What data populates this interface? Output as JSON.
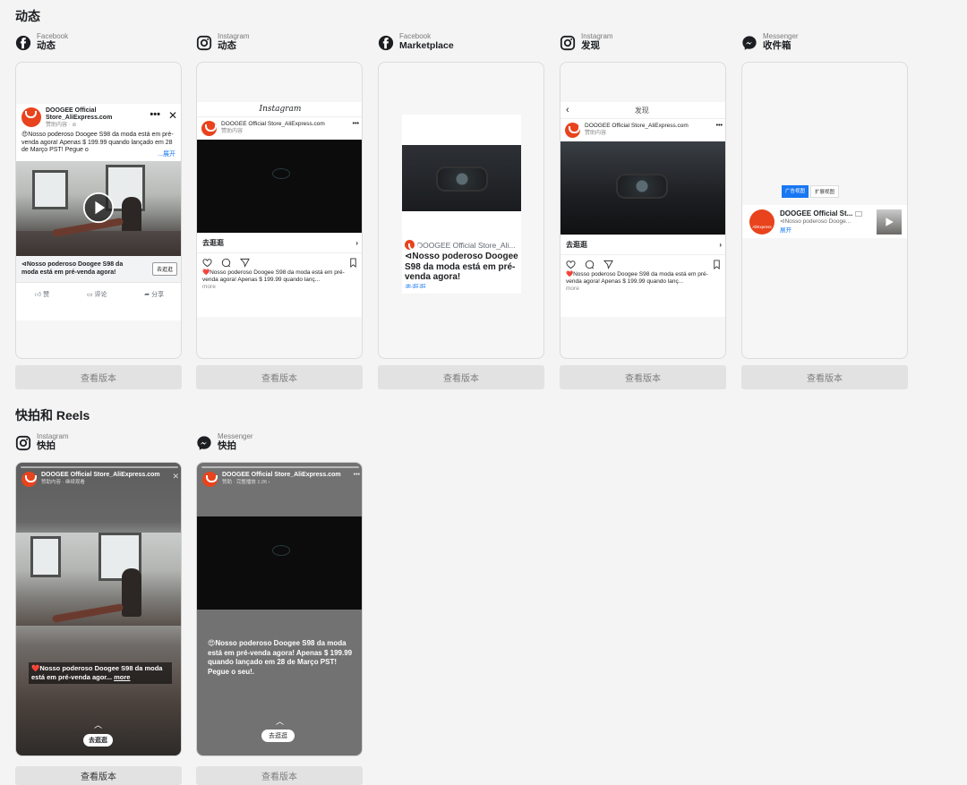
{
  "sections": {
    "feeds_title": "动态",
    "stories_title": "快拍和 Reels"
  },
  "view_label": "查看版本",
  "feeds": [
    {
      "platform": "Facebook",
      "name": "动态",
      "icon": "facebook-icon"
    },
    {
      "platform": "Instagram",
      "name": "动态",
      "icon": "instagram-icon"
    },
    {
      "platform": "Facebook",
      "name": "Marketplace",
      "icon": "facebook-icon"
    },
    {
      "platform": "Instagram",
      "name": "发现",
      "icon": "instagram-icon"
    },
    {
      "platform": "Messenger",
      "name": "收件箱",
      "icon": "messenger-icon"
    }
  ],
  "stories": [
    {
      "platform": "Instagram",
      "name": "快拍",
      "icon": "instagram-icon"
    },
    {
      "platform": "Messenger",
      "name": "快拍",
      "icon": "messenger-icon"
    }
  ],
  "fb_feed": {
    "page_name": "DOOGEE Official Store_AliExpress.com",
    "sponsored": "赞助内容 · ⊘",
    "text": "😍Nosso poderoso Doogee S98 da moda está em pré-venda agora! Apenas $ 199.99 quando lançado em 28 de Março PST! Pegue o",
    "more": "...展开",
    "headline": "⊲Nosso poderoso Doogee S98 da moda está em pré-venda agora!",
    "cta": "去逛逛",
    "like": "赞",
    "comment": "评论",
    "share": "分享"
  },
  "ig_feed": {
    "logo": "Instagram",
    "page_name": "DOOGEE Official Store_AliExpress.com",
    "sponsored": "赞助内容",
    "cta": "去逛逛",
    "caption": "❤️Nosso poderoso Doogee S98 da moda está em pré-venda agora! Apenas $ 199.99 quando lanç...",
    "more": "more"
  },
  "marketplace": {
    "page_name": "DOOGEE Official Store_Ali...",
    "headline": "⊲Nosso poderoso Doogee S98 da moda está em pré-venda agora!",
    "cta": "去逛逛"
  },
  "explore": {
    "header": "发现",
    "page_name": "DOOGEE Official Store_AliExpress.com",
    "sponsored": "赞助内容",
    "cta": "去逛逛",
    "caption": "❤️Nosso poderoso Doogee S98 da moda está em pré-venda agora! Apenas $ 199.99 quando lanç...",
    "more": "more"
  },
  "messenger_inbox": {
    "tab_ad": "广告视图",
    "tab_expanded": "扩展视图",
    "page_name": "DOOGEE Official St...",
    "preview": "⊲Nosso poderoso Dooge...",
    "expand": "展开",
    "avatar_text": "AliExpress"
  },
  "ig_story": {
    "page_name": "DOOGEE Official Store_AliExpress.com",
    "sponsored": "赞助内容 · 继续观看",
    "caption": "❤️Nosso poderoso Doogee S98 da moda está em pré-venda agor...",
    "more": "more",
    "cta": "去逛逛"
  },
  "ms_story": {
    "page_name": "DOOGEE Official Store_AliExpress.com",
    "sponsored": "赞助 · 完整播放 1:26 ›",
    "caption": "😍Nosso poderoso Doogee S98 da moda está em pré-venda agora! Apenas $ 199.99 quando lançado em 28 de Março PST! Pegue o seu!.",
    "cta": "去逛逛"
  },
  "colors": {
    "brand_red": "#e8431d",
    "messenger_blue": "#1877f2"
  }
}
